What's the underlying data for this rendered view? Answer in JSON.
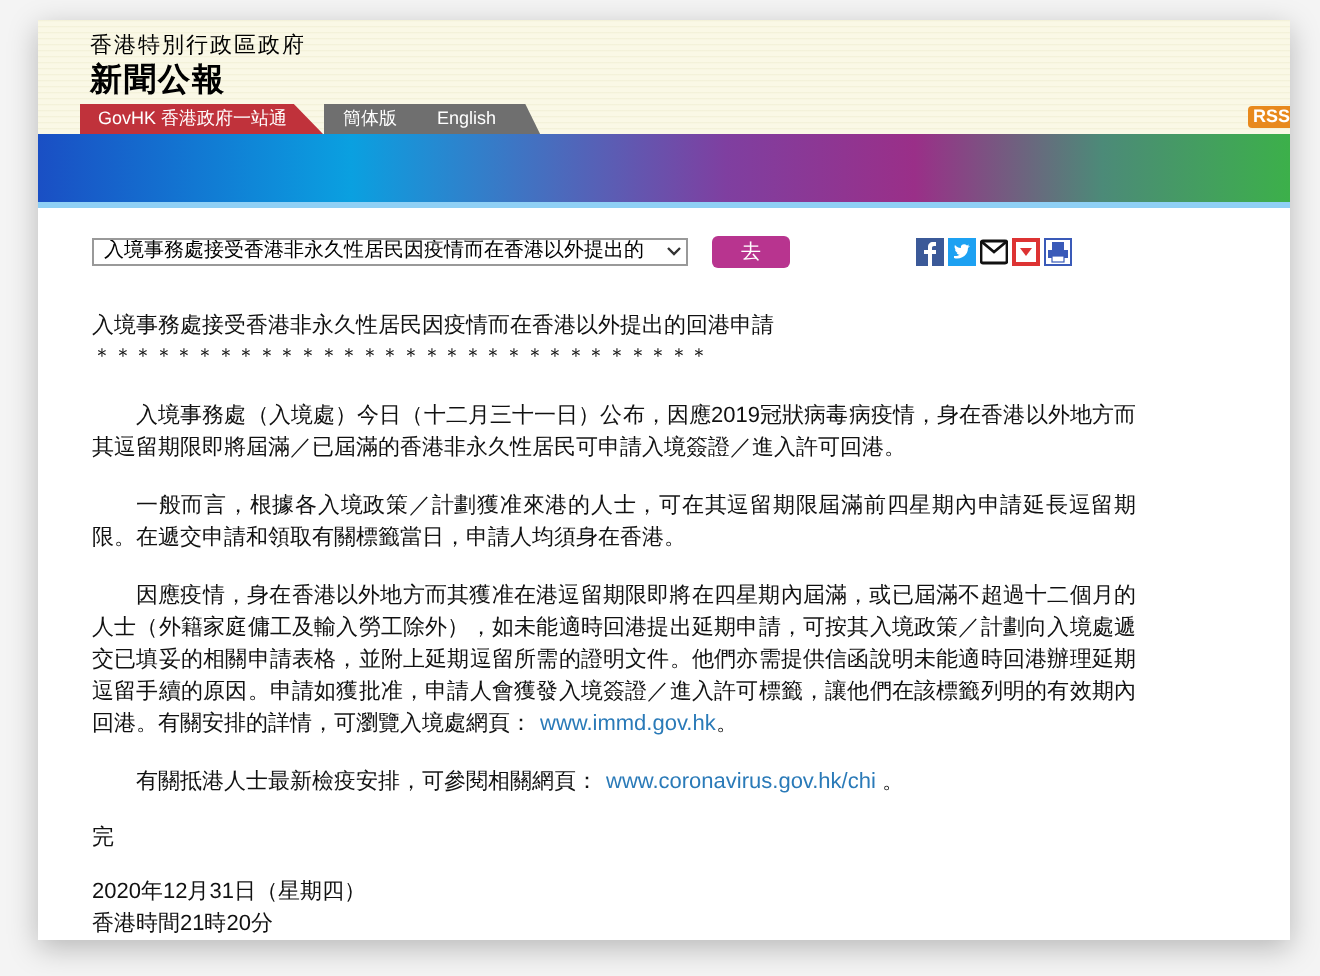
{
  "header": {
    "department": "香港特別行政區政府",
    "title": "新聞公報"
  },
  "tabs": [
    {
      "label": "GovHK 香港政府一站通",
      "selected": true
    },
    {
      "label": "簡体版",
      "selected": false
    },
    {
      "label": "English",
      "selected": false
    }
  ],
  "rss": "RSS",
  "nav": {
    "select_value": "入境事務處接受香港非永久性居民因疫情而在香港以外提出的",
    "go_button": "去"
  },
  "article": {
    "headline": "入境事務處接受香港非永久性居民因疫情而在香港以外提出的回港申請",
    "stars": "＊＊＊＊＊＊＊＊＊＊＊＊＊＊＊＊＊＊＊＊＊＊＊＊＊＊＊＊＊＊",
    "paragraphs": [
      {
        "text": "入境事務處（入境處）今日（十二月三十一日）公布，因應2019冠狀病毒病疫情，身在香港以外地方而其逗留期限即將屆滿／已屆滿的香港非永久性居民可申請入境簽證／進入許可回港。"
      },
      {
        "text": "一般而言，根據各入境政策／計劃獲准來港的人士，可在其逗留期限屆滿前四星期內申請延長逗留期限。在遞交申請和領取有關標籤當日，申請人均須身在香港。"
      },
      {
        "text": "因應疫情，身在香港以外地方而其獲准在港逗留期限即將在四星期內屆滿，或已屆滿不超過十二個月的人士（外籍家庭傭工及輸入勞工除外），如未能適時回港提出延期申請，可按其入境政策／計劃向入境處遞交已填妥的相關申請表格，並附上延期逗留所需的證明文件。他們亦需提供信函說明未能適時回港辦理延期逗留手續的原因。申請如獲批准，申請人會獲發入境簽證／進入許可標籤，讓他們在該標籤列明的有效期內回港。有關安排的詳情，可瀏覽入境處網頁：",
        "link": "www.immd.gov.hk",
        "after": "。"
      },
      {
        "text": "有關抵港人士最新檢疫安排，可參閱相關網頁：",
        "link": "www.coronavirus.gov.hk/chi",
        "after": " 。"
      }
    ],
    "end": "完",
    "date": "2020年12月31日（星期四）",
    "time": "香港時間21時20分"
  }
}
